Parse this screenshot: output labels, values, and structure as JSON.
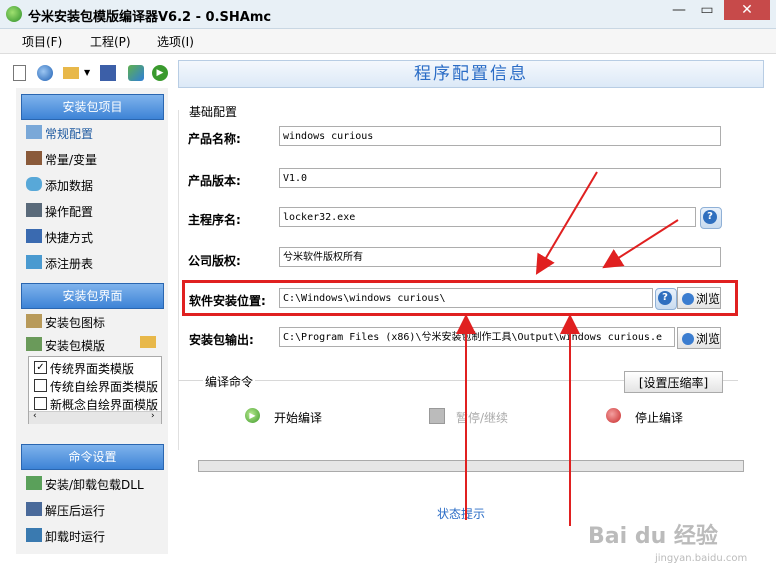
{
  "window": {
    "title": "兮米安装包模版编译器V6.2 - 0.SHAmc",
    "minimize": "—",
    "maximize": "▭",
    "close": "✕"
  },
  "menu": [
    "项目(F)",
    "工程(P)",
    "选项(I)"
  ],
  "sidebar": {
    "project_section": "安装包项目",
    "project_items": [
      "常规配置",
      "常量/变量",
      "添加数据",
      "操作配置",
      "快捷方式",
      "添注册表"
    ],
    "ui_section": "安装包界面",
    "ui_items": [
      "安装包图标",
      "安装包模版"
    ],
    "templates": [
      {
        "label": "传统界面类模版",
        "checked": true
      },
      {
        "label": "传统自绘界面类模版",
        "checked": false
      },
      {
        "label": "新概念自绘界面模版",
        "checked": false
      }
    ],
    "cmd_section": "命令设置",
    "cmd_items": [
      "安装/卸载包载DLL",
      "解压后运行",
      "卸载时运行"
    ]
  },
  "main": {
    "header": "程序配置信息",
    "basic_group": "基础配置",
    "fields": {
      "product_name": {
        "label": "产品名称:",
        "value": "windows curious"
      },
      "product_version": {
        "label": "产品版本:",
        "value": "V1.0"
      },
      "main_program": {
        "label": "主程序名:",
        "value": "locker32.exe"
      },
      "copyright": {
        "label": "公司版权:",
        "value": "兮米软件版权所有"
      },
      "install_location": {
        "label": "软件安装位置:",
        "value": "C:\\Windows\\windows curious\\"
      },
      "package_output": {
        "label": "安装包输出:",
        "value": "C:\\Program Files (x86)\\兮米安装包制作工具\\Output\\windows curious.e"
      }
    },
    "browse_label": "浏览",
    "compile_group": "编译命令",
    "compression_button": "[设置压缩率]",
    "start_compile": "开始编译",
    "pause_resume": "暂停/继续",
    "stop_compile": "停止编译",
    "status_hint": "状态提示"
  },
  "watermark": {
    "text": "Bai du 经验",
    "url": "jingyan.baidu.com"
  }
}
